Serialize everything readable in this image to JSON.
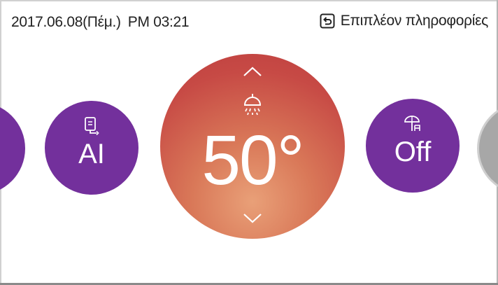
{
  "header": {
    "date": "2017.06.08(Πέμ.)",
    "time": "PM 03:21",
    "more_info_label": "Επιπλέον πληροφορίες",
    "more_info_icon": "back-arrow-icon"
  },
  "modes": {
    "ai": {
      "label": "AI",
      "icon": "water-heater-icon"
    },
    "off": {
      "label": "Off",
      "icon": "vacation-umbrella-icon"
    }
  },
  "temperature": {
    "value": "50°",
    "icon": "shower-icon",
    "increase_icon": "chevron-up-icon",
    "decrease_icon": "chevron-down-icon"
  },
  "colors": {
    "mode_purple": "#73309c",
    "temperature_red": "#c74a45",
    "temperature_orange": "#e9a078",
    "inactive_grey": "#a7a7a7"
  }
}
